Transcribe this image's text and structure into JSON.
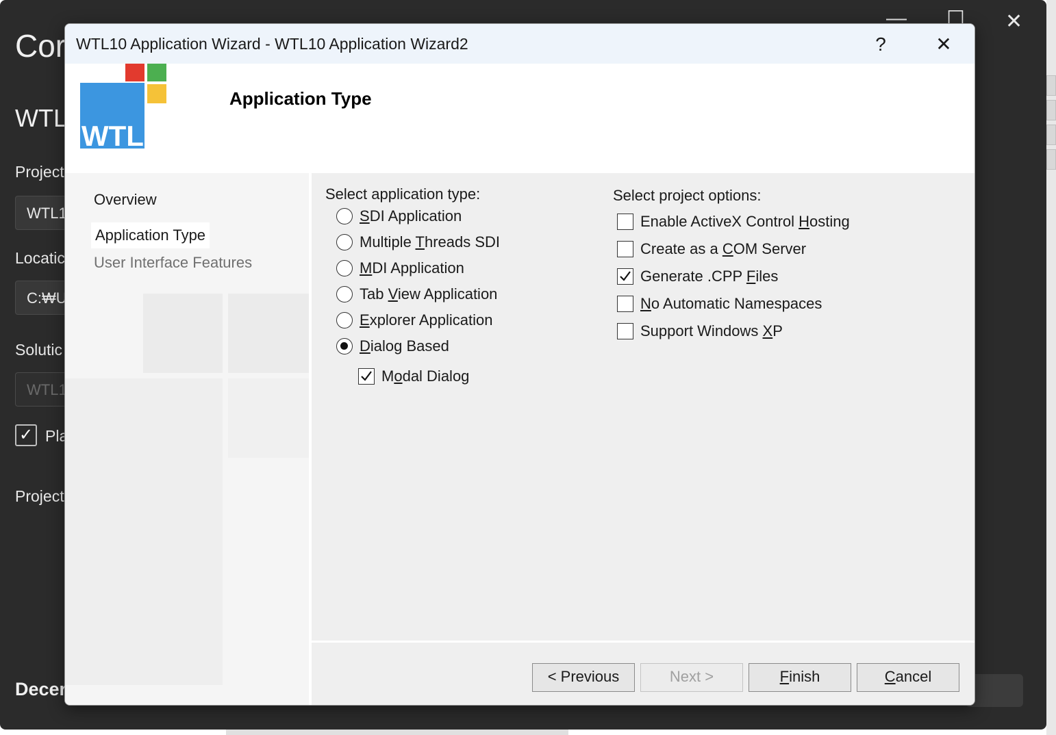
{
  "background_window": {
    "title": "Cor",
    "subtitle": "WTL",
    "project_label": "Project",
    "project_value": "WTL1",
    "location_label": "Locatic",
    "location_value": "C:₩U",
    "solution_label": "Solutic",
    "solution_value": "WTL1",
    "place_label": "Pla",
    "project2_label": "Project",
    "bottom_text": "Decer",
    "minimize_icon": "minimize-icon",
    "maximize_icon": "maximize-icon",
    "close_icon": "close-icon"
  },
  "dialog": {
    "title": "WTL10 Application Wizard - WTL10 Application Wizard2",
    "help_label": "?",
    "close_label": "✕",
    "logo_text": "WTL",
    "logo_colors": {
      "blue": "#3c96e0",
      "red": "#e23a2e",
      "green": "#4caf50",
      "yellow": "#f5c238"
    },
    "heading": "Application Type",
    "nav": [
      {
        "label": "Overview"
      },
      {
        "label": "Application Type"
      },
      {
        "label": "User Interface Features"
      }
    ],
    "app_type": {
      "label": "Select application type:",
      "options": [
        {
          "pre": "",
          "ul": "S",
          "post": "DI Application",
          "checked": false
        },
        {
          "pre": "Multiple ",
          "ul": "T",
          "post": "hreads SDI",
          "checked": false
        },
        {
          "pre": "",
          "ul": "M",
          "post": "DI Application",
          "checked": false
        },
        {
          "pre": "Tab ",
          "ul": "V",
          "post": "iew Application",
          "checked": false
        },
        {
          "pre": "",
          "ul": "E",
          "post": "xplorer Application",
          "checked": false
        },
        {
          "pre": "",
          "ul": "D",
          "post": "ialog Based",
          "checked": true
        }
      ],
      "modal": {
        "pre": "M",
        "ul": "o",
        "post": "dal Dialog",
        "checked": true
      }
    },
    "project_options": {
      "label": "Select project options:",
      "options": [
        {
          "pre": "Enable ActiveX Control ",
          "ul": "H",
          "post": "osting",
          "checked": false
        },
        {
          "pre": "Create as a ",
          "ul": "C",
          "post": "OM Server",
          "checked": false
        },
        {
          "pre": "Generate .CPP ",
          "ul": "F",
          "post": "iles",
          "checked": true
        },
        {
          "pre": "",
          "ul": "N",
          "post": "o Automatic Namespaces",
          "checked": false
        },
        {
          "pre": "Support Windows ",
          "ul": "X",
          "post": "P",
          "checked": false
        }
      ]
    },
    "buttons": {
      "previous": "< Previous",
      "next": "Next >",
      "finish_ul": "F",
      "finish_rest": "inish",
      "cancel_ul": "C",
      "cancel_rest": "ancel"
    }
  }
}
